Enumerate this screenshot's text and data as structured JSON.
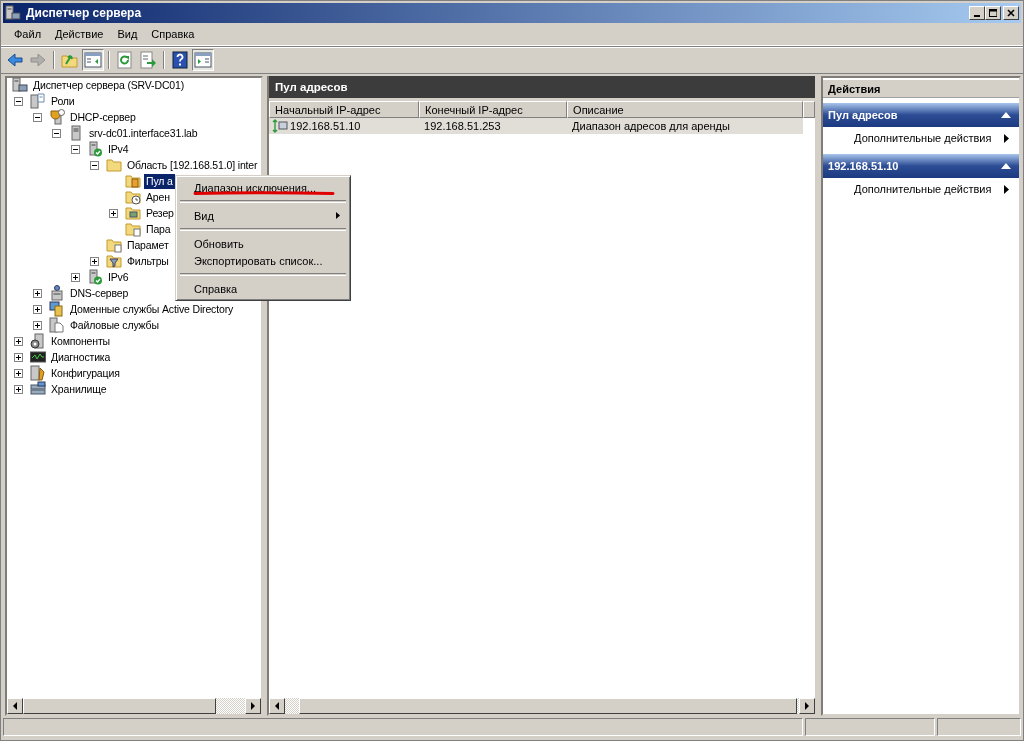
{
  "window": {
    "title": "Диспетчер сервера"
  },
  "menu_bar": [
    "Файл",
    "Действие",
    "Вид",
    "Справка"
  ],
  "toolbar": [
    {
      "kind": "back",
      "disabled": false,
      "pressed": false
    },
    {
      "kind": "forward",
      "disabled": true,
      "pressed": false
    },
    {
      "kind": "separator"
    },
    {
      "kind": "up",
      "disabled": false,
      "pressed": false
    },
    {
      "kind": "console_tree",
      "disabled": false,
      "pressed": true
    },
    {
      "kind": "separator"
    },
    {
      "kind": "refresh",
      "disabled": false,
      "pressed": false
    },
    {
      "kind": "export",
      "disabled": false,
      "pressed": false
    },
    {
      "kind": "separator"
    },
    {
      "kind": "help",
      "disabled": false,
      "pressed": false
    },
    {
      "kind": "action_pane",
      "disabled": false,
      "pressed": true
    }
  ],
  "tree": [
    {
      "label": "Диспетчер сервера (SRV-DC01)",
      "kind": "computer",
      "selected": false,
      "children": [
        {
          "label": "Роли",
          "kind": "roles",
          "expanded": true,
          "selected": false,
          "children": [
            {
              "label": "DHCP-сервер",
              "kind": "dhcp",
              "expanded": true,
              "selected": false,
              "children": [
                {
                  "label": "srv-dc01.interface31.lab",
                  "kind": "server",
                  "expanded": true,
                  "selected": false,
                  "children": [
                    {
                      "label": "IPv4",
                      "kind": "network",
                      "expanded": true,
                      "selected": false,
                      "children": [
                        {
                          "label": "Область [192.168.51.0] inter",
                          "kind": "folder",
                          "expanded": true,
                          "selected": false,
                          "children": [
                            {
                              "label": "Пул а",
                              "kind": "pool",
                              "selected": true
                            },
                            {
                              "label": "Арен",
                              "kind": "leases",
                              "selected": false
                            },
                            {
                              "label": "Резер",
                              "kind": "reservations",
                              "expanded": false,
                              "selected": false
                            },
                            {
                              "label": "Пара",
                              "kind": "options",
                              "selected": false
                            }
                          ]
                        },
                        {
                          "label": "Парамет",
                          "kind": "options",
                          "selected": false
                        },
                        {
                          "label": "Фильтры",
                          "kind": "filter",
                          "expanded": false,
                          "selected": false
                        }
                      ]
                    },
                    {
                      "label": "IPv6",
                      "kind": "network",
                      "expanded": false,
                      "selected": false
                    }
                  ]
                }
              ]
            },
            {
              "label": "DNS-сервер",
              "kind": "dns",
              "expanded": false,
              "selected": false
            },
            {
              "label": "Доменные службы Active Directory",
              "kind": "directory",
              "expanded": false,
              "selected": false
            },
            {
              "label": "Файловые службы",
              "kind": "files",
              "expanded": false,
              "selected": false
            }
          ]
        },
        {
          "label": "Компоненты",
          "kind": "features",
          "expanded": false,
          "selected": false
        },
        {
          "label": "Диагностика",
          "kind": "diagnostics",
          "expanded": false,
          "selected": false
        },
        {
          "label": "Конфигурация",
          "kind": "config",
          "expanded": false,
          "selected": false
        },
        {
          "label": "Хранилище",
          "kind": "storage",
          "expanded": false,
          "selected": false
        }
      ]
    }
  ],
  "center": {
    "title": "Пул адресов",
    "columns": [
      "Начальный IP-адрес",
      "Конечный IP-адрес",
      "Описание"
    ],
    "rows": [
      {
        "cells": [
          "192.168.51.10",
          "192.168.51.253",
          "Диапазон адресов для аренды"
        ],
        "selected": true
      }
    ]
  },
  "actions": {
    "title": "Действия",
    "sections": [
      {
        "title": "Пул адресов",
        "expanded": true,
        "items": [
          {
            "label": "Дополнительные действия",
            "submenu": true
          }
        ]
      },
      {
        "title": "192.168.51.10",
        "expanded": true,
        "items": [
          {
            "label": "Дополнительные действия",
            "submenu": true
          }
        ]
      }
    ]
  },
  "context_menu": {
    "items": [
      {
        "kind": "item",
        "label": "Диапазон исключения...",
        "underlined": true
      },
      {
        "kind": "separator"
      },
      {
        "kind": "submenu",
        "label": "Вид",
        "underlined": false
      },
      {
        "kind": "separator"
      },
      {
        "kind": "item",
        "label": "Обновить",
        "underlined": false
      },
      {
        "kind": "item",
        "label": "Экспортировать список...",
        "underlined": false
      },
      {
        "kind": "separator"
      },
      {
        "kind": "item",
        "label": "Справка",
        "underlined": false
      }
    ]
  }
}
